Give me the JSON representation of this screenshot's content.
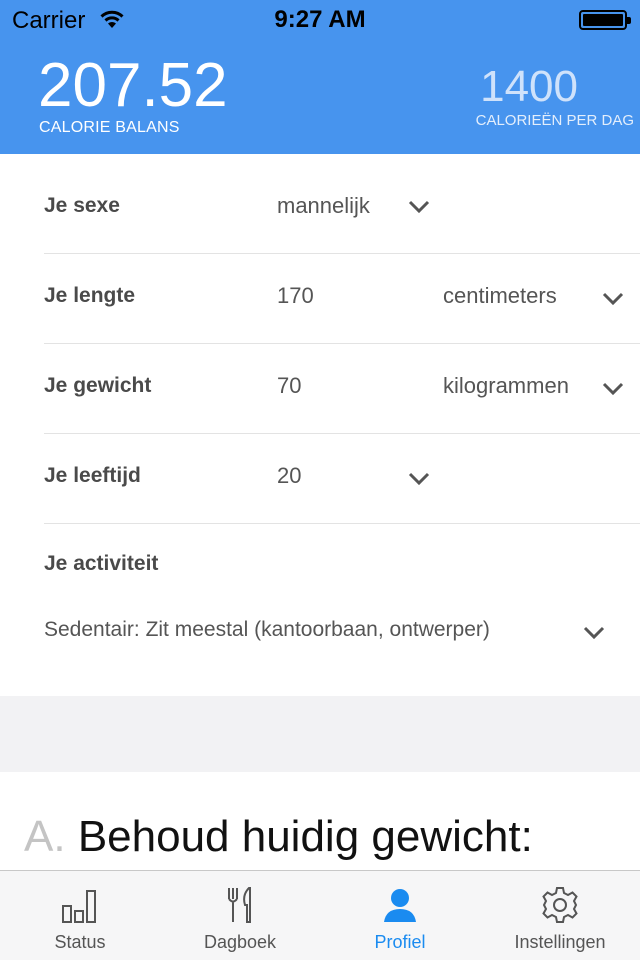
{
  "status_bar": {
    "carrier": "Carrier",
    "time": "9:27 AM",
    "battery_level": 1.0
  },
  "header": {
    "balance_value": "207.52",
    "balance_label": "CALORIE BALANS",
    "perday_value": "1400",
    "perday_label": "CALORIEËN PER DAG",
    "background_color": "#4794ee"
  },
  "profile": {
    "sex": {
      "label": "Je sexe",
      "value": "mannelijk"
    },
    "height": {
      "label": "Je lengte",
      "value": "170",
      "unit": "centimeters"
    },
    "weight": {
      "label": "Je gewicht",
      "value": "70",
      "unit": "kilogrammen"
    },
    "age": {
      "label": "Je leeftijd",
      "value": "20"
    },
    "activity": {
      "label": "Je activiteit",
      "value": "Sedentair: Zit meestal (kantoorbaan, ontwerper)"
    }
  },
  "goal": {
    "letter": "A.",
    "title": "Behoud huidig gewicht:"
  },
  "tabbar": {
    "active_color": "#1a8bf0",
    "tabs": [
      {
        "label": "Status",
        "icon": "bar-chart-icon"
      },
      {
        "label": "Dagboek",
        "icon": "fork-knife-icon"
      },
      {
        "label": "Profiel",
        "icon": "person-icon",
        "active": true
      },
      {
        "label": "Instellingen",
        "icon": "gear-icon"
      }
    ]
  }
}
